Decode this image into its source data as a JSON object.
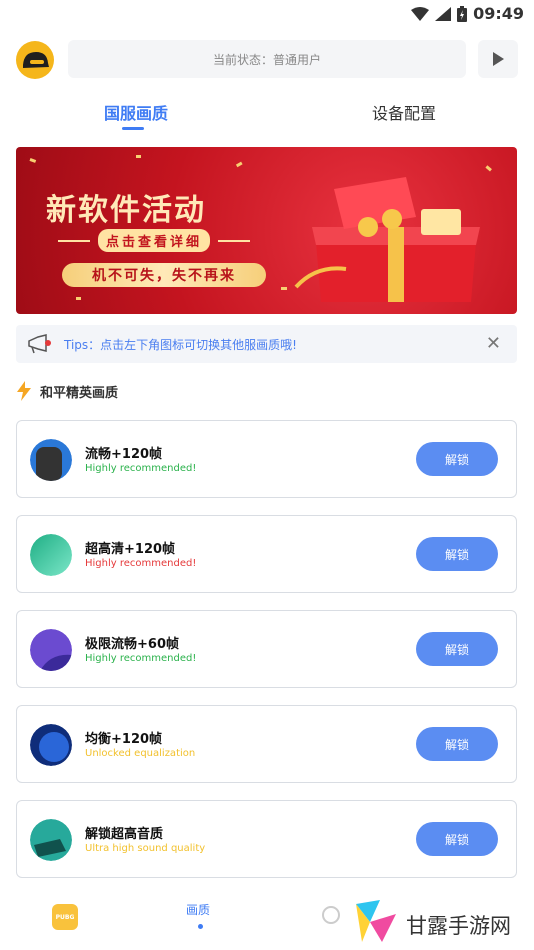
{
  "status_bar": {
    "time": "09:49"
  },
  "header": {
    "status_text": "当前状态：普通用户"
  },
  "tabs": [
    {
      "label": "国服画质",
      "active": true
    },
    {
      "label": "设备配置",
      "active": false
    }
  ],
  "banner": {
    "title": "新软件活动",
    "subtitle": "点击查看详细",
    "slogan": "机不可失，失不再来"
  },
  "tips": {
    "text": "Tips：点击左下角图标可切换其他服画质哦!"
  },
  "section": {
    "title": "和平精英画质"
  },
  "cards": [
    {
      "title": "流畅+120帧",
      "subtitle": "Highly recommended!",
      "subtitle_color": "#2bb24c",
      "button": "解锁",
      "icon_color": "#2a78d8"
    },
    {
      "title": "超高清+120帧",
      "subtitle": "Highly recommended!",
      "subtitle_color": "#e5393a",
      "button": "解锁",
      "icon_color": "#2fcf9c"
    },
    {
      "title": "极限流畅+60帧",
      "subtitle": "Highly recommended!",
      "subtitle_color": "#2bb24c",
      "button": "解锁",
      "icon_color": "#6b4bd0"
    },
    {
      "title": "均衡+120帧",
      "subtitle": "Unlocked equalization",
      "subtitle_color": "#f2c12e",
      "button": "解锁",
      "icon_color": "#1f4fb8"
    },
    {
      "title": "解锁超高音质",
      "subtitle": "Ultra high sound quality",
      "subtitle_color": "#f2c12e",
      "button": "解锁",
      "icon_color": "#27a99b"
    }
  ],
  "bottom_nav": {
    "mine_icon_label": "PUBG",
    "quality_label": "画质"
  },
  "watermark": {
    "text": "甘露手游网"
  },
  "colors": {
    "accent": "#3f7cf4",
    "button": "#5b8df2"
  }
}
